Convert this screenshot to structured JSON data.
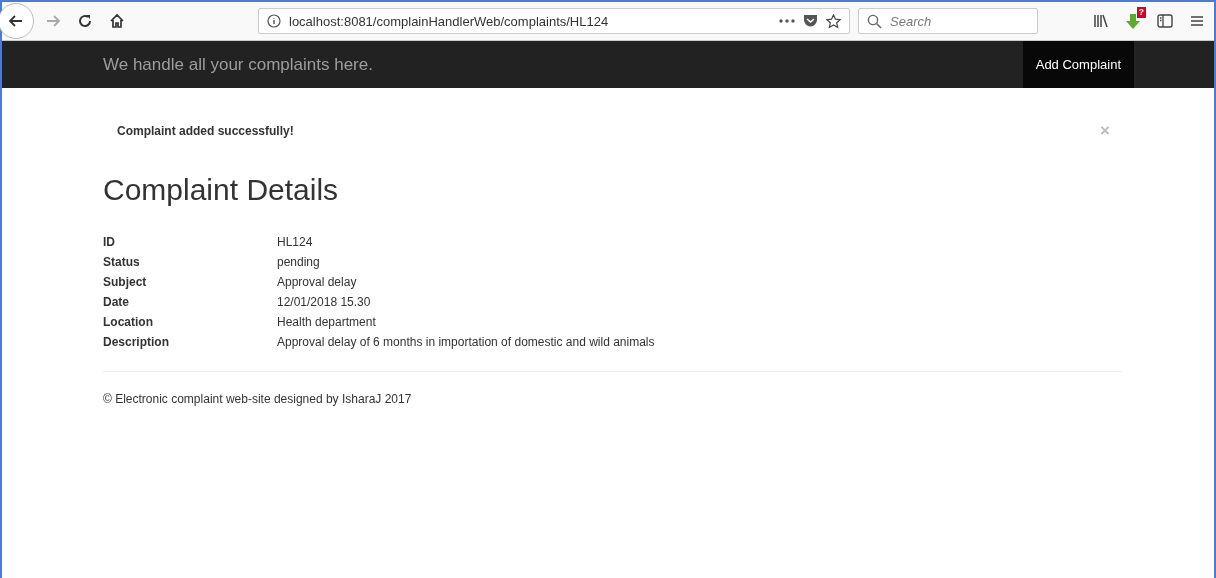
{
  "browser": {
    "url": "localhost:8081/complainHandlerWeb/complaints/HL124",
    "search": {
      "placeholder": "Search"
    },
    "download_badge": "?",
    "back_enabled": true,
    "forward_enabled": false
  },
  "navbar": {
    "brand": "We handle all your complaints here.",
    "links": [
      {
        "label": "Add Complaint",
        "selected": true
      }
    ]
  },
  "alert": {
    "message": "Complaint added successfully!",
    "close": "×"
  },
  "heading": "Complaint Details",
  "details": [
    {
      "label": "ID",
      "value": "HL124"
    },
    {
      "label": "Status",
      "value": "pending"
    },
    {
      "label": "Subject",
      "value": "Approval delay"
    },
    {
      "label": "Date",
      "value": "12/01/2018 15.30"
    },
    {
      "label": "Location",
      "value": "Health department"
    },
    {
      "label": "Description",
      "value": "Approval delay of 6 months in importation of domestic and wild animals"
    }
  ],
  "footer": "© Electronic complaint web-site designed by IsharaJ 2017"
}
